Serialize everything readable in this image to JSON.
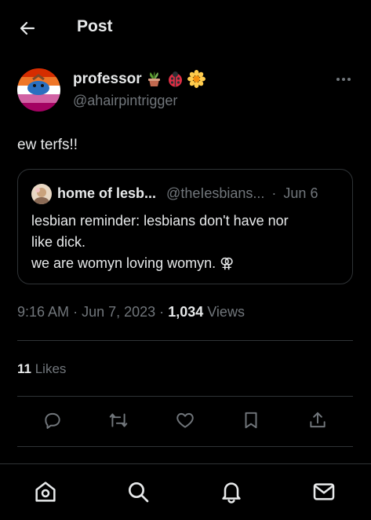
{
  "header": {
    "title": "Post",
    "back_icon": "arrow-left-icon"
  },
  "author": {
    "display_name": "professor",
    "emojis": [
      "potted-plant-emoji",
      "ladybug-emoji",
      "blossom-emoji"
    ],
    "handle": "@ahairpintrigger",
    "avatar": "lesbian-flag-avatar"
  },
  "tweet": {
    "text": "ew terfs!!"
  },
  "quote": {
    "name": "home of lesb...",
    "handle": "@theIesbians...",
    "separator": "·",
    "date": "Jun 6",
    "text_line1": "lesbian reminder: lesbians don't have nor",
    "text_line2": "like dick.",
    "text_line3": "we are womyn loving womyn. ⚢"
  },
  "meta": {
    "time": "9:16 AM",
    "sep1": "·",
    "date": "Jun 7, 2023",
    "sep2": "·",
    "views_count": "1,034",
    "views_label": "Views"
  },
  "stats": {
    "likes_count": "11",
    "likes_label": "Likes"
  },
  "actions": [
    "reply-icon",
    "repost-icon",
    "like-icon",
    "bookmark-icon",
    "share-icon"
  ],
  "nav": [
    "home-icon",
    "search-icon",
    "notifications-icon",
    "messages-icon"
  ],
  "colors": {
    "background": "#000000",
    "text": "#e7e9ea",
    "secondary": "#71767b",
    "border": "#2f3336"
  }
}
